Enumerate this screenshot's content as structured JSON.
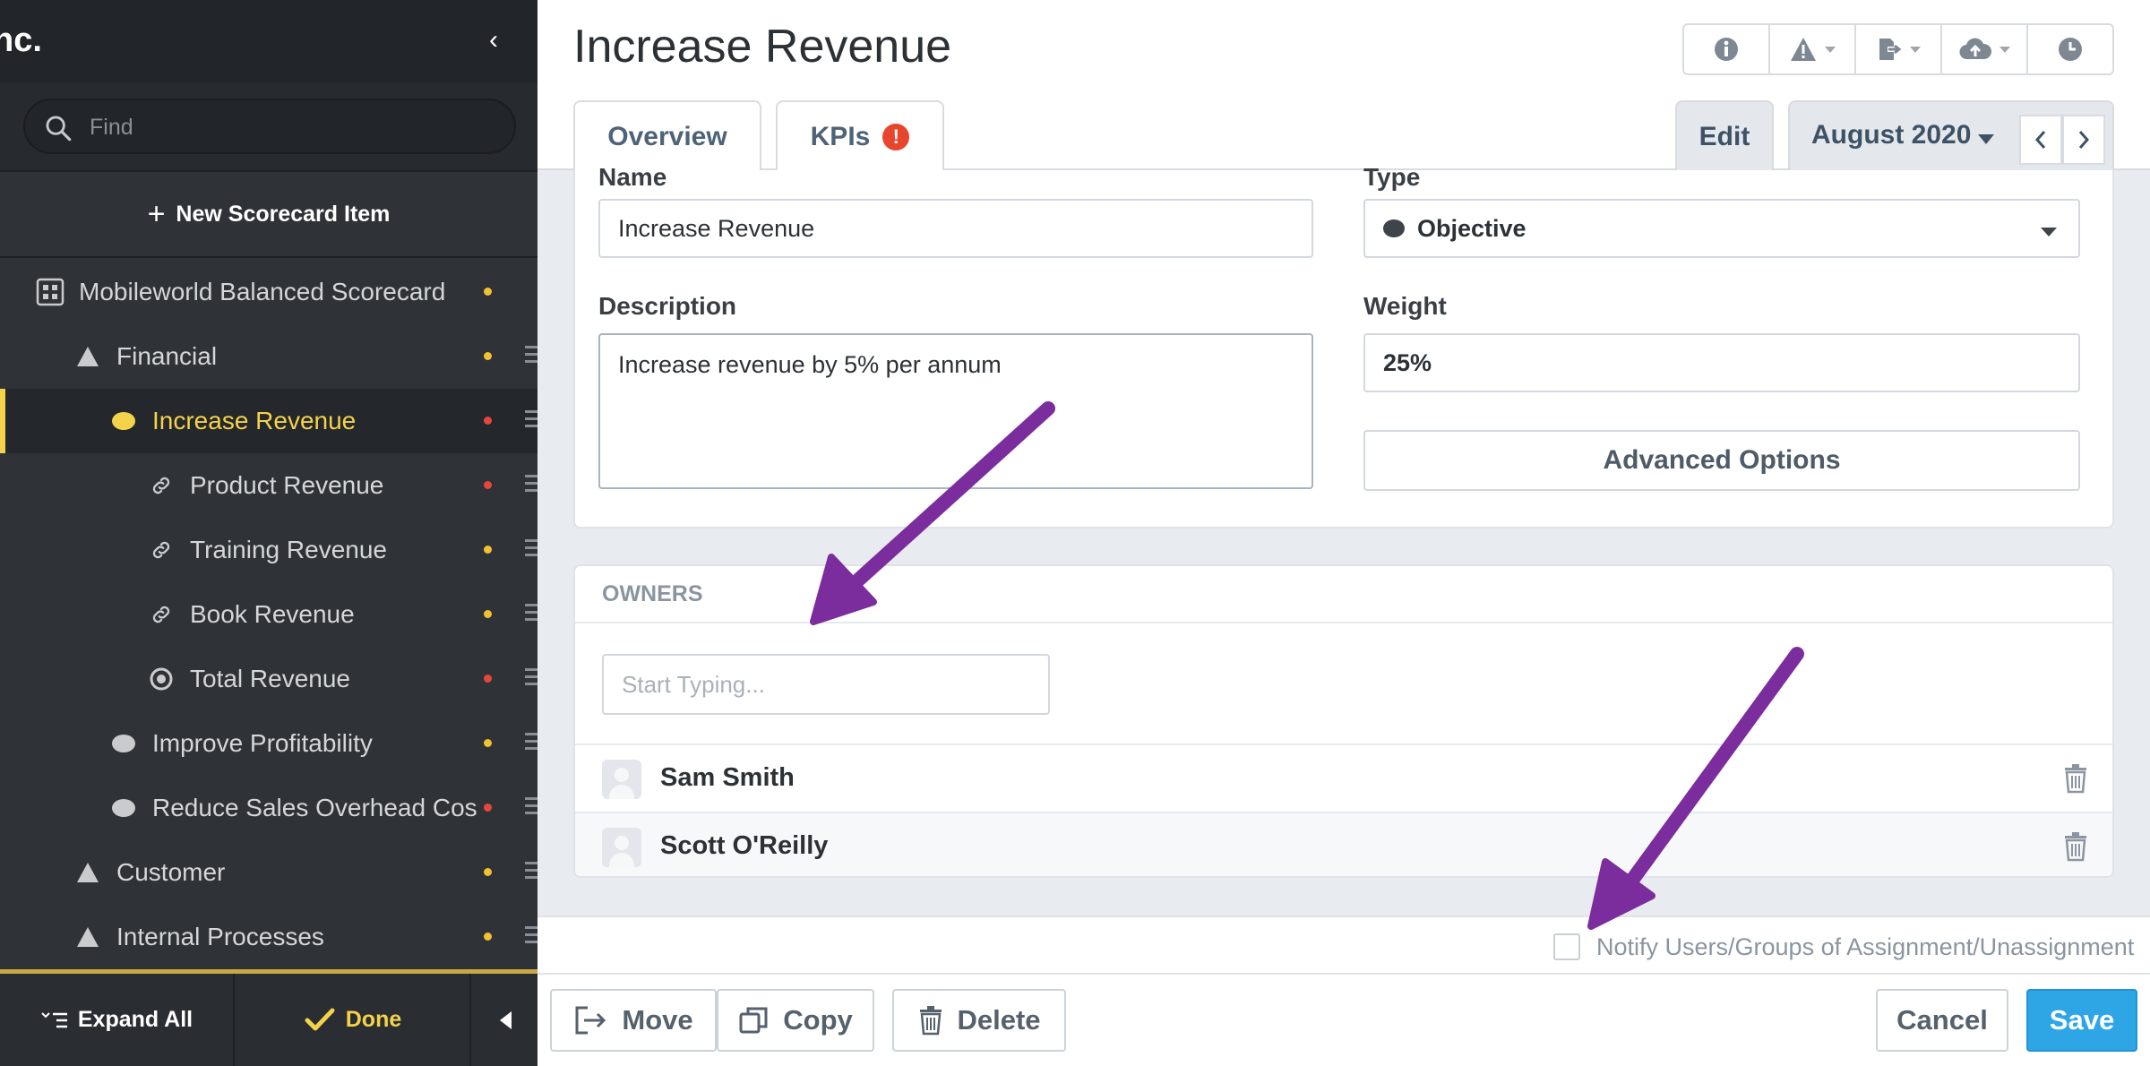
{
  "sidebar": {
    "org_fragment": "nc.",
    "search_placeholder": "Find",
    "new_item_label": "New Scorecard Item",
    "items": [
      {
        "label": "Mobileworld Balanced Scorecard",
        "status": "yellow",
        "icon": "scorecard-icon"
      },
      {
        "label": "Financial",
        "status": "yellow",
        "icon": "triangle-icon"
      },
      {
        "label": "Increase Revenue",
        "status": "red",
        "icon": "oval-icon",
        "active": true
      },
      {
        "label": "Product Revenue",
        "status": "red",
        "icon": "link-icon"
      },
      {
        "label": "Training Revenue",
        "status": "yellow",
        "icon": "link-icon"
      },
      {
        "label": "Book Revenue",
        "status": "yellow",
        "icon": "link-icon"
      },
      {
        "label": "Total Revenue",
        "status": "red",
        "icon": "target-icon"
      },
      {
        "label": "Improve Profitability",
        "status": "yellow",
        "icon": "oval-icon"
      },
      {
        "label": "Reduce Sales Overhead Cos",
        "status": "red",
        "icon": "oval-icon"
      },
      {
        "label": "Customer",
        "status": "yellow",
        "icon": "triangle-icon"
      },
      {
        "label": "Internal Processes",
        "status": "yellow",
        "icon": "triangle-icon"
      }
    ],
    "expand_all_label": "Expand All",
    "done_label": "Done"
  },
  "header": {
    "title": "Increase Revenue",
    "tabs": [
      {
        "label": "Overview"
      },
      {
        "label": "KPIs",
        "badge": "!"
      }
    ],
    "edit_label": "Edit",
    "period_label": "August 2020"
  },
  "form": {
    "name_label": "Name",
    "name_value": "Increase Revenue",
    "type_label": "Type",
    "type_value": "Objective",
    "description_label": "Description",
    "description_value": "Increase revenue by 5% per annum",
    "weight_label": "Weight",
    "weight_value": "25%",
    "advanced_label": "Advanced Options"
  },
  "owners": {
    "heading": "OWNERS",
    "input_placeholder": "Start Typing...",
    "list": [
      {
        "name": "Sam Smith"
      },
      {
        "name": "Scott O'Reilly"
      }
    ]
  },
  "notify": {
    "label": "Notify Users/Groups of Assignment/Unassignment",
    "checked": false
  },
  "footer": {
    "move_label": "Move",
    "copy_label": "Copy",
    "delete_label": "Delete",
    "cancel_label": "Cancel",
    "save_label": "Save"
  },
  "colors": {
    "accent_yellow": "#f4d24a",
    "status_yellow": "#f2c230",
    "status_red": "#e8463d",
    "save_blue": "#2ea6e6",
    "annotation_purple": "#7b2d9e"
  }
}
